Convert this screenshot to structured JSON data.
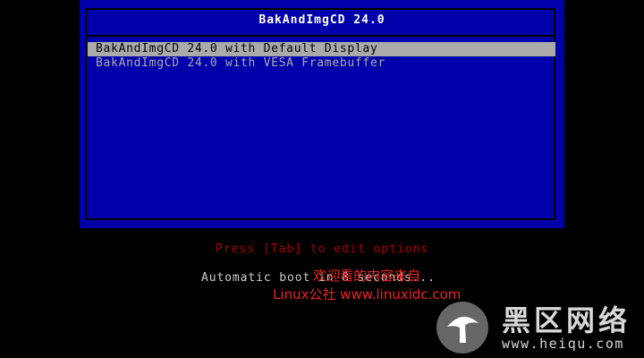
{
  "boot_menu": {
    "title": "BakAndImgCD 24.0",
    "items": [
      {
        "label": "BakAndImgCD 24.0 with Default Display",
        "selected": true
      },
      {
        "label": "BakAndImgCD 24.0 with VESA Framebuffer",
        "selected": false
      }
    ]
  },
  "hint": "Press [Tab] to edit options",
  "countdown": "Automatic boot in 8 seconds...",
  "watermark": {
    "line1": "欢迎看的内容来自",
    "line2": "Linux公社 www.linuxidc.com",
    "logo_text": "黑区网络",
    "logo_url": "www.heiqu.com"
  },
  "colors": {
    "panel_bg": "#0000aa",
    "selection_bg": "#aaaaaa",
    "hint_text": "#aa0000",
    "watermark_red": "#ee2222"
  }
}
